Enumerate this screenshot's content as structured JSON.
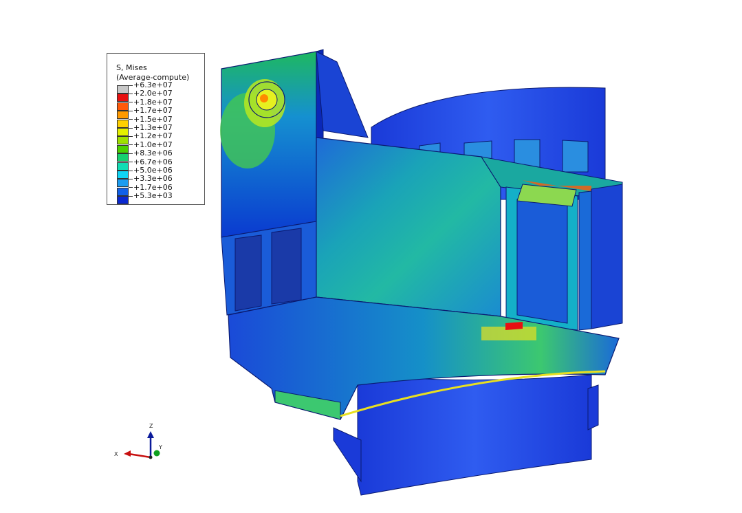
{
  "legend": {
    "title_line1": "S, Mises",
    "title_line2": "(Average-compute)",
    "entries": [
      {
        "value": "+6.3e+07",
        "color": "#c8c8c8"
      },
      {
        "value": "+2.0e+07",
        "color": "#e81010"
      },
      {
        "value": "+1.8e+07",
        "color": "#ff5a0a"
      },
      {
        "value": "+1.7e+07",
        "color": "#ff9a00"
      },
      {
        "value": "+1.5e+07",
        "color": "#ffd000"
      },
      {
        "value": "+1.3e+07",
        "color": "#e4f000"
      },
      {
        "value": "+1.2e+07",
        "color": "#9ee000"
      },
      {
        "value": "+1.0e+07",
        "color": "#4cd000"
      },
      {
        "value": "+8.3e+06",
        "color": "#18d070"
      },
      {
        "value": "+6.7e+06",
        "color": "#12dcb4"
      },
      {
        "value": "+5.0e+06",
        "color": "#10d4f4"
      },
      {
        "value": "+3.3e+06",
        "color": "#1c9cf0"
      },
      {
        "value": "+1.7e+06",
        "color": "#1060e8"
      },
      {
        "value": "+5.3e+03",
        "color": "#0a28d0"
      }
    ]
  },
  "triad": {
    "z_label": "Z",
    "x_label": "X",
    "y_label": "Y"
  }
}
